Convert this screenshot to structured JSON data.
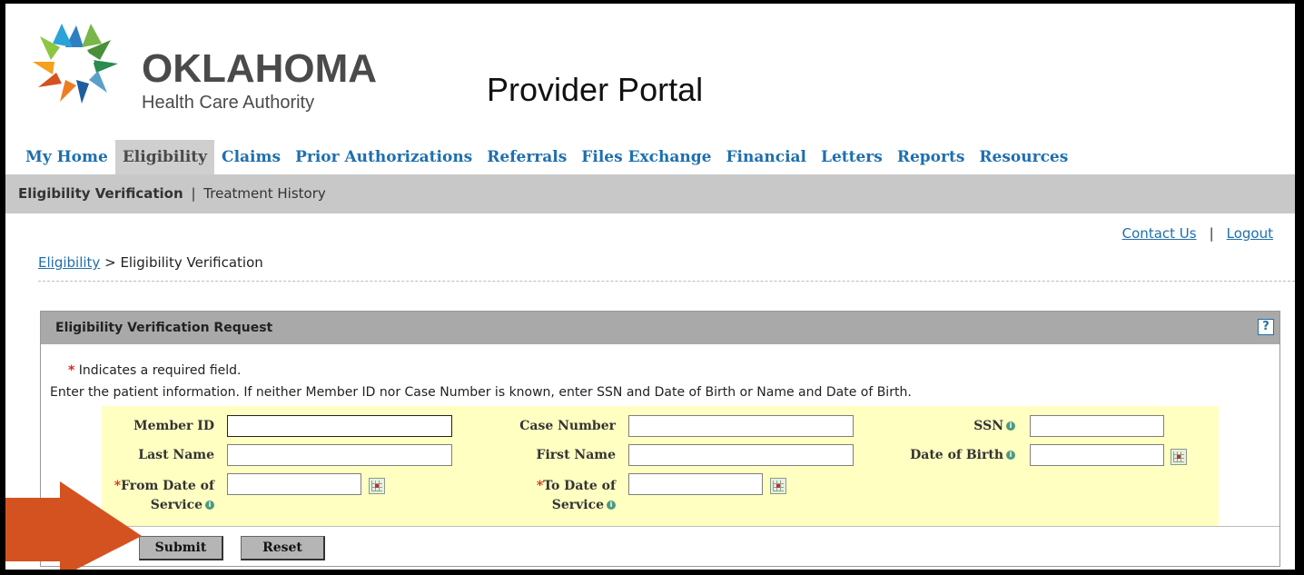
{
  "brand": {
    "name": "OKLAHOMA",
    "subtitle": "Health Care Authority"
  },
  "portal_title": "Provider Portal",
  "nav": {
    "items": [
      "My Home",
      "Eligibility",
      "Claims",
      "Prior Authorizations",
      "Referrals",
      "Files Exchange",
      "Financial",
      "Letters",
      "Reports",
      "Resources"
    ],
    "active": "Eligibility"
  },
  "subnav": {
    "active": "Eligibility Verification",
    "separator": "|",
    "other": "Treatment History"
  },
  "toplinks": {
    "contact": "Contact Us",
    "separator": "|",
    "logout": "Logout"
  },
  "breadcrumb": {
    "link": "Eligibility",
    "separator": ">",
    "current": "Eligibility Verification"
  },
  "panel": {
    "title": "Eligibility Verification Request",
    "help_icon": "?",
    "required_star": "*",
    "required_note": "Indicates a required field.",
    "instructions": "Enter the patient information. If neither Member ID nor Case Number is known, enter SSN and Date of Birth or Name and Date of Birth."
  },
  "form": {
    "member_id": {
      "label": "Member ID",
      "value": ""
    },
    "case_number": {
      "label": "Case Number",
      "value": ""
    },
    "ssn": {
      "label": "SSN",
      "value": ""
    },
    "last_name": {
      "label": "Last Name",
      "value": ""
    },
    "first_name": {
      "label": "First Name",
      "value": ""
    },
    "dob": {
      "label": "Date of Birth",
      "value": ""
    },
    "from_dos": {
      "label_line1": "From Date of",
      "label_line2": "Service",
      "value": ""
    },
    "to_dos": {
      "label_line1": "To Date of",
      "label_line2": "Service",
      "value": ""
    }
  },
  "buttons": {
    "submit": "Submit",
    "reset": "Reset"
  },
  "icons": {
    "info": "info-icon",
    "calendar": "calendar-icon",
    "help": "help-icon"
  },
  "colors": {
    "nav_link": "#1e6fae",
    "form_bg": "#ffffc2",
    "required": "#e02020",
    "arrow": "#d4521f"
  }
}
